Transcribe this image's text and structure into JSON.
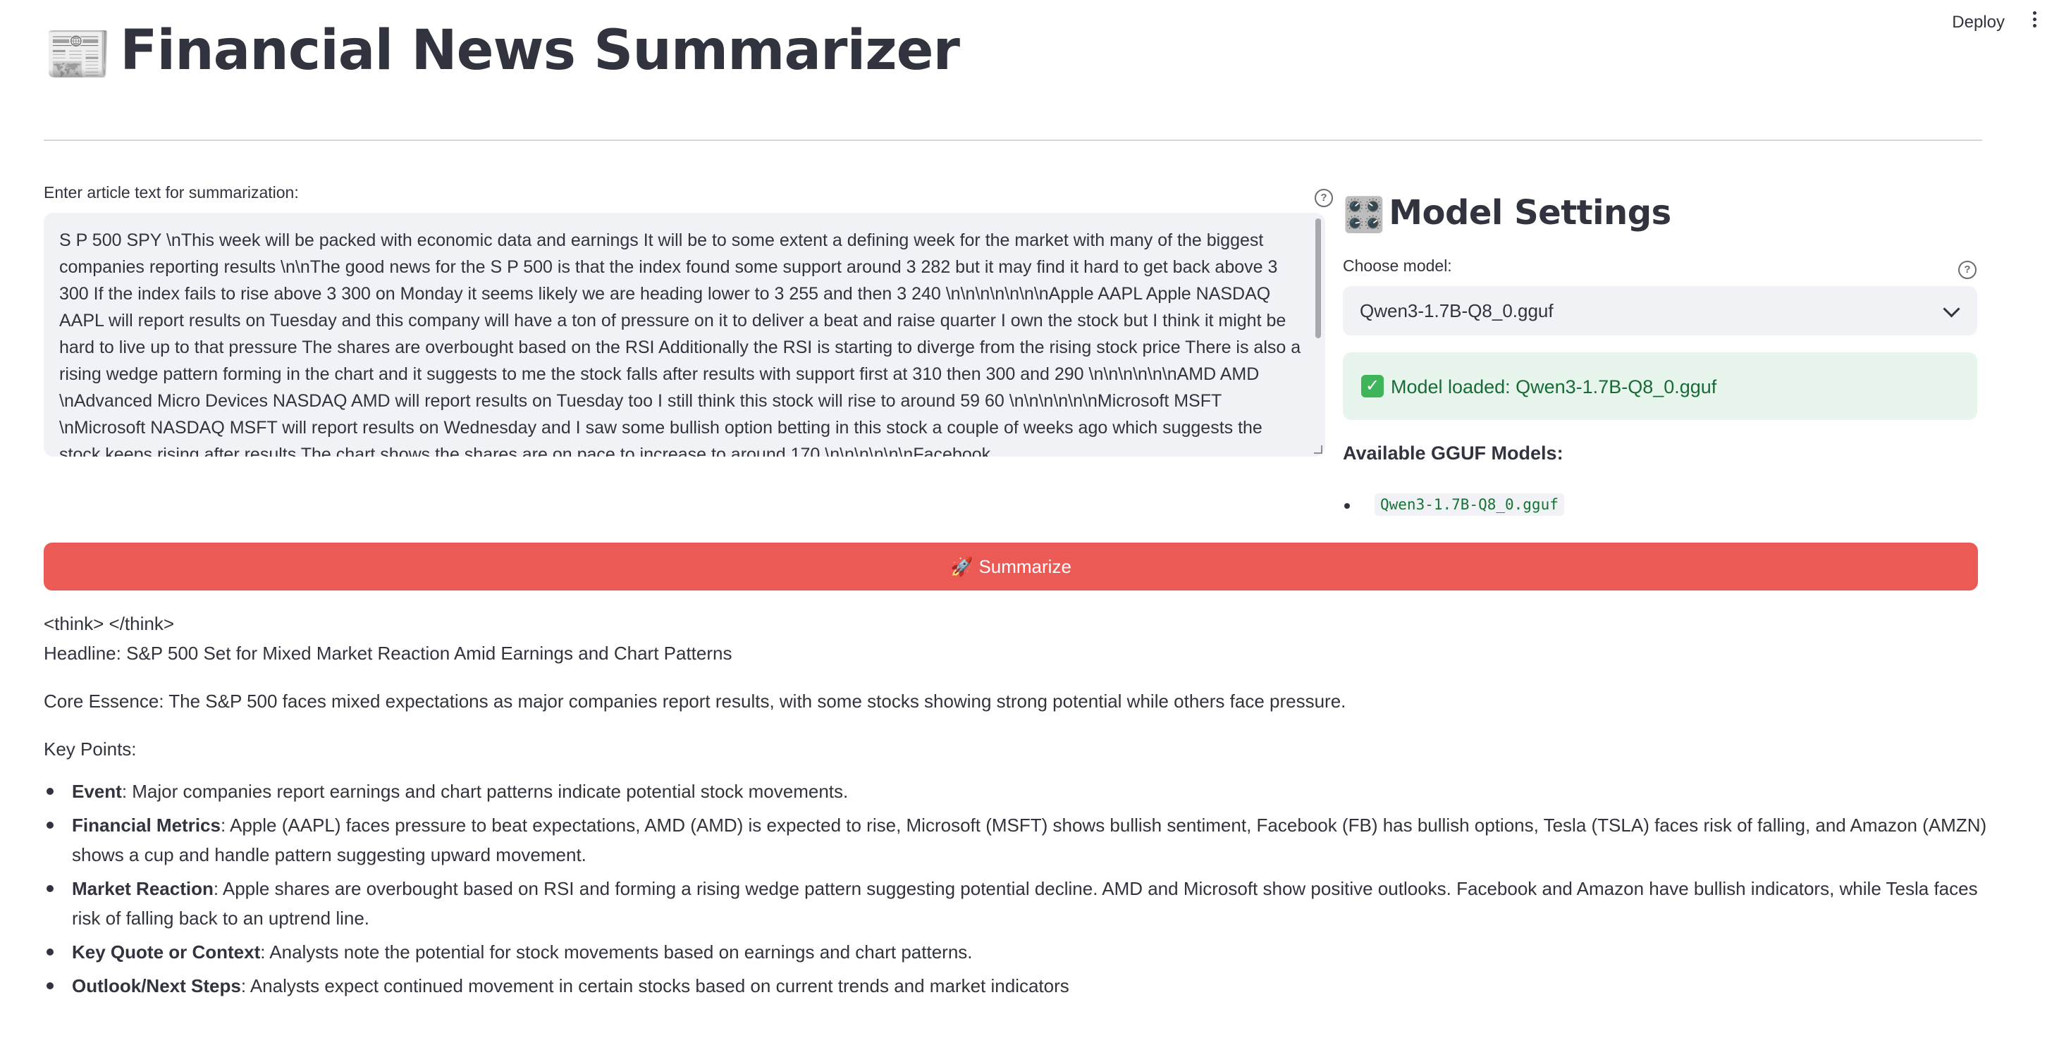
{
  "app": {
    "title": "Financial News Summarizer",
    "title_emoji": "📰",
    "deploy_label": "Deploy",
    "divider": true
  },
  "input": {
    "label": "Enter article text for summarization:",
    "value": "S P 500  SPY \\nThis week will be packed with economic data and earnings  It will be  to some extent  a defining week for the market  with many of the biggest companies reporting results \\n\\nThe good news for the S P 500 is that the index found some support around 3 282  but it may find it hard to get back above 3 300  If the index fails to rise above 3 300 on Monday  it seems likely we are heading lower to 3 255  and then 3 240 \\n\\n\\n\\n\\n\\n\\nApple  AAPL Apple NASDAQ AAPL  will report results on Tuesday  and this company will have a ton of pressure on it to deliver a beat and raise quarter  I own the stock  but I think it might be hard to live up to that pressure  The shares are overbought based on the RSI  Additionally  the RSI is starting to diverge from the rising stock price  There is also a rising wedge pattern forming in the chart  and it suggests to me the stock falls after results  with support first at  310  then  300  and  290 \\n\\n\\n\\n\\n\\nAMD  AMD \\nAdvanced Micro Devices  NASDAQ AMD  will report results on Tuesday  too  I still think this stock will rise to around  59  60 \\n\\n\\n\\n\\n\\nMicrosoft  MSFT \\nMicrosoft  NASDAQ MSFT  will report results on Wednesday  and I saw some bullish option betting in this stock a couple of weeks ago  which suggests the stock keeps rising after results  The chart shows the shares are on pace to increase to around  170  \\n\\n\\n\\n\\n\\nFacebook"
  },
  "settings": {
    "title": "Model Settings",
    "title_emoji": "🎛️",
    "choose_label": "Choose model:",
    "selected_model": "Qwen3-1.7B-Q8_0.gguf",
    "status_message": "Model loaded: Qwen3-1.7B-Q8_0.gguf",
    "status_icon": "check-mark-icon",
    "available_title": "Available GGUF Models:",
    "available_models": [
      "Qwen3-1.7B-Q8_0.gguf"
    ]
  },
  "summarize": {
    "label": "Summarize",
    "emoji": "🚀",
    "color": "#ec5a55"
  },
  "output": {
    "think": "<think> </think>",
    "headline": "Headline: S&P 500 Set for Mixed Market Reaction Amid Earnings and Chart Patterns",
    "core": "Core Essence: The S&P 500 faces mixed expectations as major companies report results, with some stocks showing strong potential while others face pressure.",
    "key_points_title": "Key Points:",
    "points": [
      {
        "label": "Event",
        "text": ": Major companies report earnings and chart patterns indicate potential stock movements."
      },
      {
        "label": "Financial Metrics",
        "text": ": Apple (AAPL) faces pressure to beat expectations, AMD (AMD) is expected to rise, Microsoft (MSFT) shows bullish sentiment, Facebook (FB) has bullish options, Tesla (TSLA) faces risk of falling, and Amazon (AMZN) shows a cup and handle pattern suggesting upward movement."
      },
      {
        "label": "Market Reaction",
        "text": ": Apple shares are overbought based on RSI and forming a rising wedge pattern suggesting potential decline. AMD and Microsoft show positive outlooks. Facebook and Amazon have bullish indicators, while Tesla faces risk of falling back to an uptrend line."
      },
      {
        "label": "Key Quote or Context",
        "text": ": Analysts note the potential for stock movements based on earnings and chart patterns."
      },
      {
        "label": "Outlook/Next Steps",
        "text": ": Analysts expect continued movement in certain stocks based on current trends and market indicators"
      }
    ]
  },
  "colors": {
    "accent": "#ec5a55",
    "success_bg": "#e8f5ec",
    "success_text": "#176c35",
    "input_bg": "#f0f2f6",
    "text": "#31333f"
  }
}
